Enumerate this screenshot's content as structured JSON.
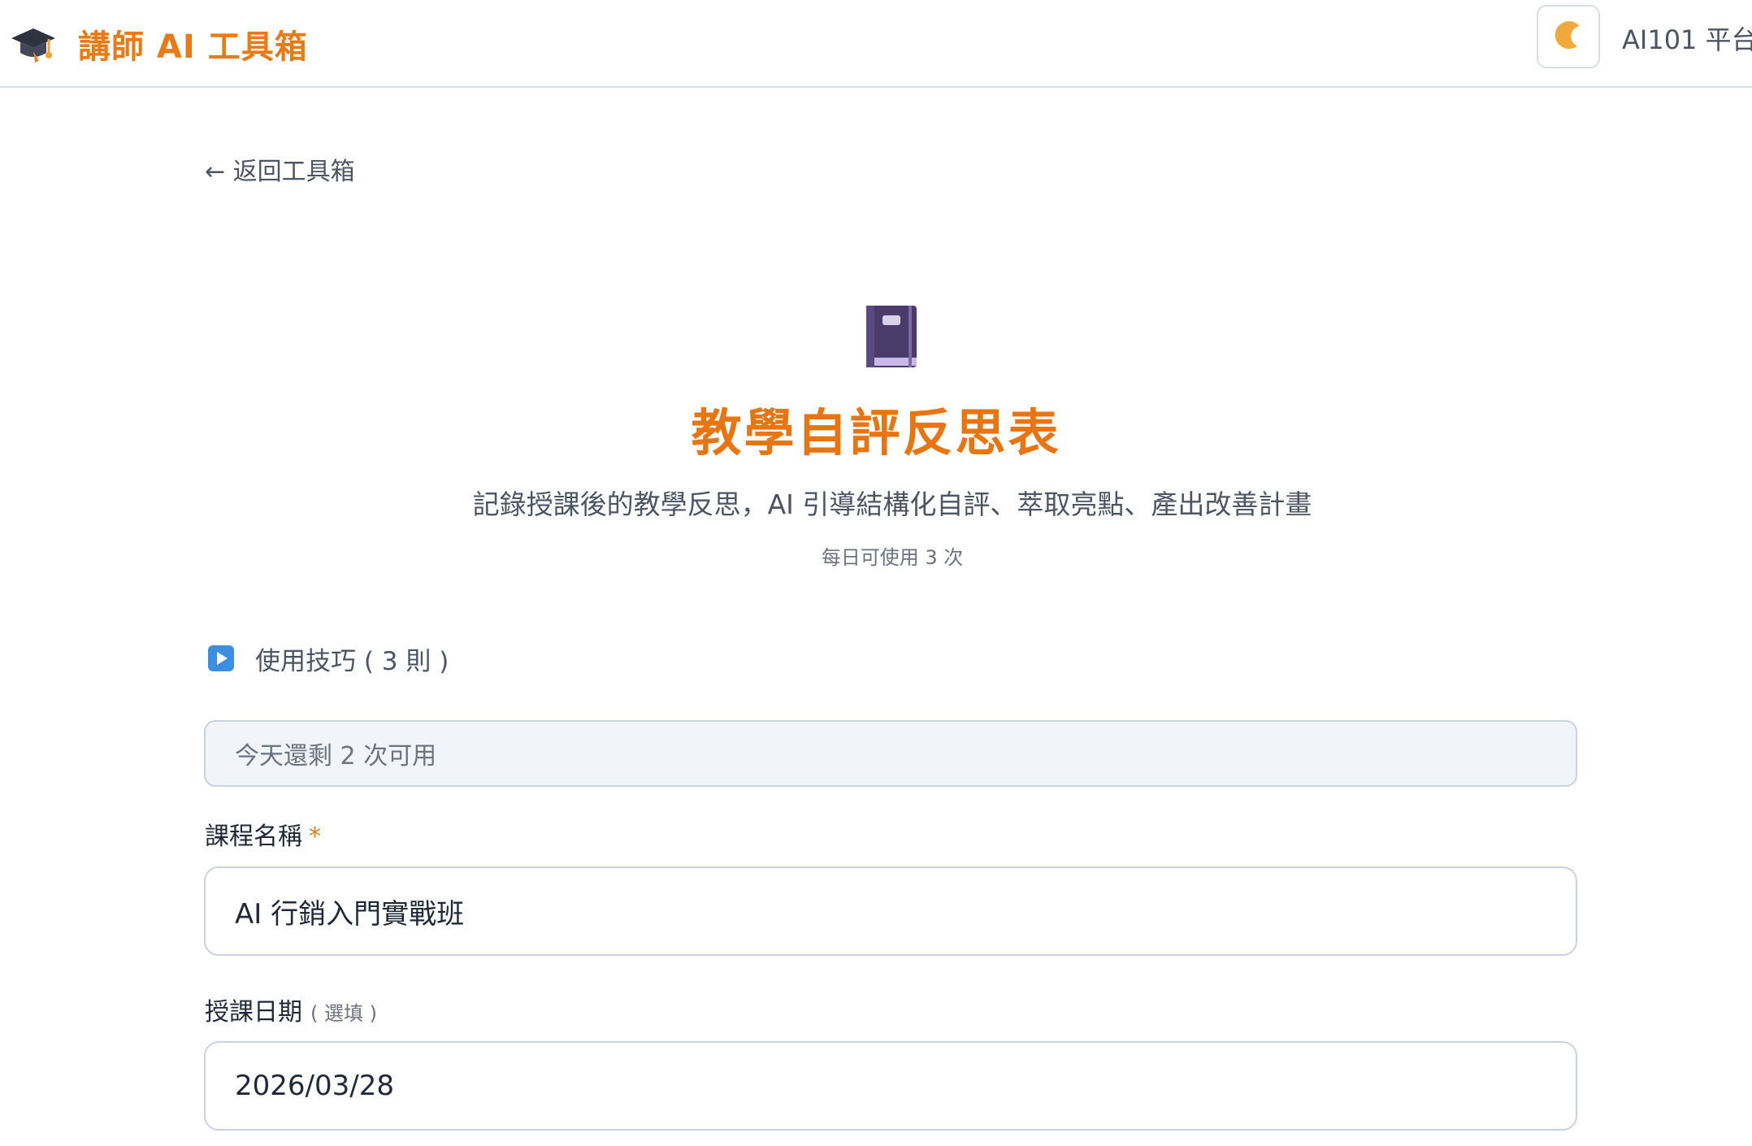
{
  "header": {
    "brand_title": "講師 AI 工具箱",
    "brand_icon": "graduation-cap-icon",
    "theme_icon": "crescent-moon-icon",
    "platform_link": "AI101 平台"
  },
  "nav": {
    "back_link": "← 返回工具箱"
  },
  "hero": {
    "icon": "notebook-icon",
    "title": "教學自評反思表",
    "description": "記錄授課後的教學反思，AI 引導結構化自評、萃取亮點、產出改善計畫",
    "quota": "每日可使用 3 次"
  },
  "tips": {
    "icon": "play-button-icon",
    "label": "使用技巧 ( 3 則 )"
  },
  "usage": {
    "remaining": "今天還剩 2 次可用"
  },
  "form": {
    "course_name": {
      "label": "課程名稱",
      "required_mark": "*",
      "value": "AI 行銷入門實戰班"
    },
    "teaching_date": {
      "label": "授課日期",
      "optional_mark": "( 選填 )",
      "value": "2026/03/28"
    }
  },
  "colors": {
    "brand_orange": "#ea7a14",
    "title_orange": "#e97510",
    "border": "#c9d2de",
    "muted_bg": "#f1f4f8"
  }
}
